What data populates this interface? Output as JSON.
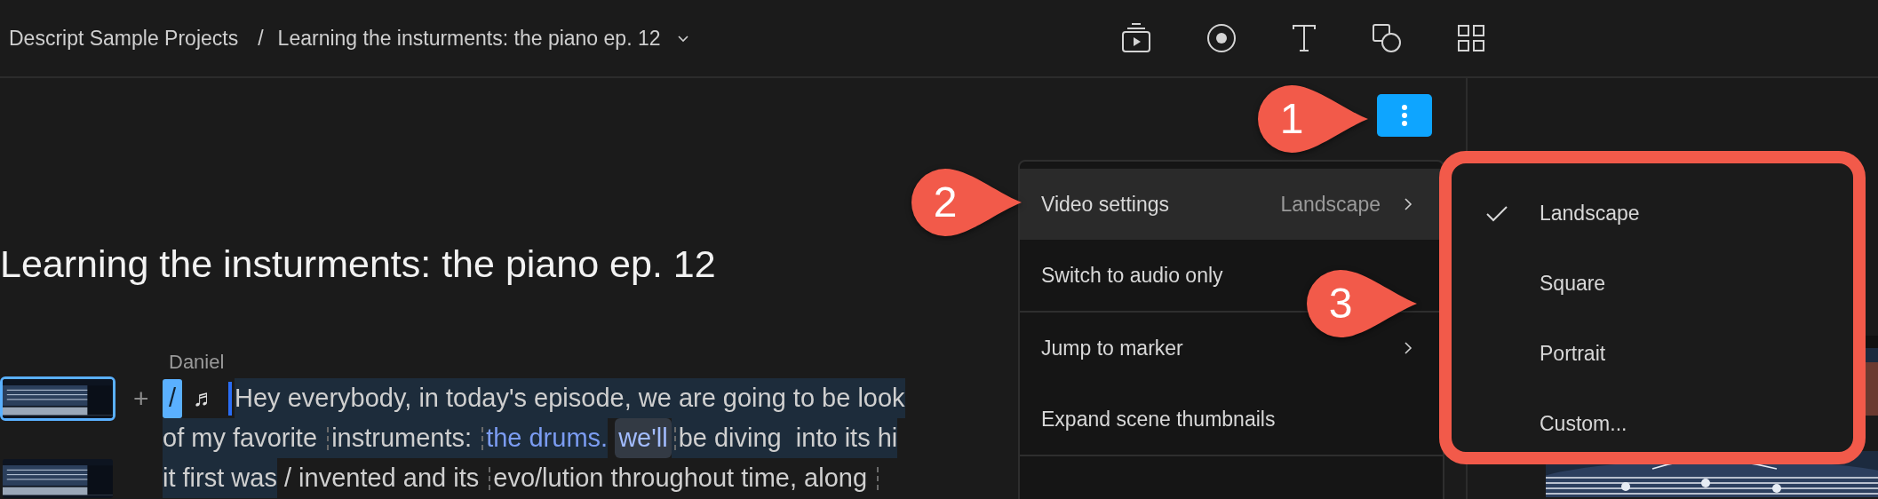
{
  "breadcrumb": {
    "project": "Descript Sample Projects",
    "separator": "/",
    "title": "Learning the insturments: the piano ep. 12"
  },
  "document_title": "Learning the insturments: the piano ep. 12",
  "transcript": {
    "speaker": "Daniel",
    "add": "+",
    "marker": "/",
    "music": "♬",
    "lines": [
      {
        "thumbnail": true,
        "segments": [
          {
            "kind": "text",
            "text": "Hey everybody, in today's episode, we are going to be look",
            "selected": true
          }
        ]
      },
      {
        "thumbnail": false,
        "segments": [
          {
            "kind": "text",
            "text": "of my favorite ",
            "selected": true
          },
          {
            "kind": "gap",
            "selected": true
          },
          {
            "kind": "text",
            "text": "instruments: ",
            "selected": true
          },
          {
            "kind": "gap",
            "selected": true
          },
          {
            "kind": "link",
            "text": "the drums.",
            "selected": true
          },
          {
            "kind": "tag",
            "text": "we'll",
            "selected": true
          },
          {
            "kind": "gap",
            "selected": true
          },
          {
            "kind": "text",
            "text": "be diving  into its hi",
            "selected": true
          }
        ]
      },
      {
        "thumbnail": true,
        "segments": [
          {
            "kind": "text",
            "text": "it first was",
            "selected": true
          },
          {
            "kind": "text",
            "text": " / invented and its ",
            "selected": false
          },
          {
            "kind": "gap",
            "selected": false
          },
          {
            "kind": "text",
            "text": "evo/lution throughout time, along ",
            "selected": false
          },
          {
            "kind": "gap",
            "selected": false
          }
        ]
      }
    ]
  },
  "menu": {
    "sections": [
      [
        {
          "label": "Video settings",
          "value": "Landscape",
          "submenu": true,
          "selected": true
        },
        {
          "label": "Switch to audio only",
          "submenu": false,
          "selected": false
        }
      ],
      [
        {
          "label": "Jump to marker",
          "submenu": true,
          "selected": false
        },
        {
          "label": "Expand scene thumbnails",
          "submenu": false,
          "selected": false
        }
      ]
    ]
  },
  "submenu": {
    "items": [
      {
        "label": "Landscape",
        "checked": true
      },
      {
        "label": "Square",
        "checked": false
      },
      {
        "label": "Portrait",
        "checked": false
      },
      {
        "label": "Custom...",
        "checked": false
      }
    ]
  },
  "callouts": [
    {
      "label": "1"
    },
    {
      "label": "2"
    },
    {
      "label": "3"
    }
  ]
}
